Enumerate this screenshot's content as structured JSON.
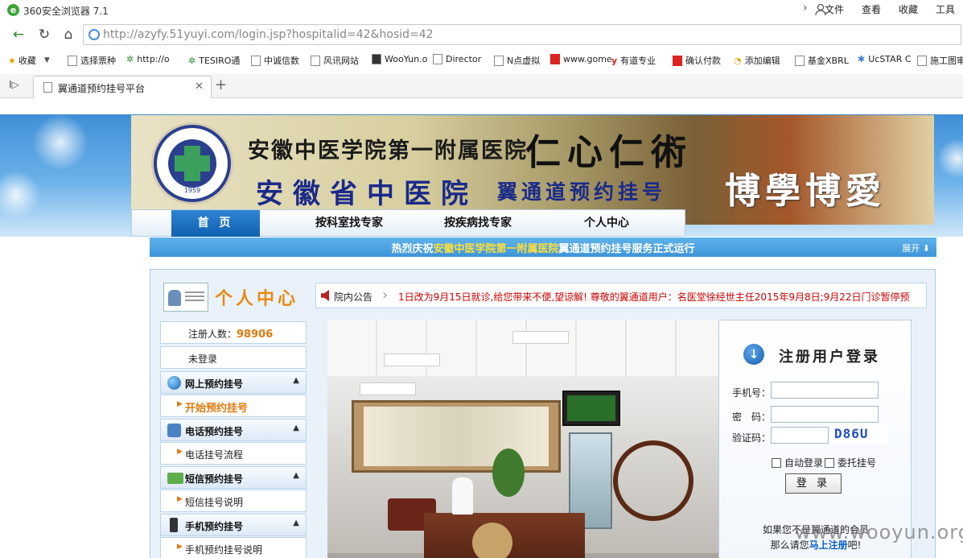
{
  "browser": {
    "app_title": "360安全浏览器 7.1",
    "menus": [
      "文件",
      "查看",
      "收藏",
      "工具"
    ],
    "url": "http://azyfy.51yuyi.com/login.jsp?hospitalid=42&hosid=42",
    "bookmarks": [
      "收藏",
      "选择票种",
      "http://o",
      "TESIRO通",
      "中诚信数",
      "风讯网站",
      "WooYun.o",
      "Director",
      "N点虚拟",
      "www.gome",
      "有道专业",
      "确认付款",
      "添加编辑",
      "基金XBRL",
      "UcSTAR C",
      "施工图审"
    ],
    "tab_title": "翼通道预约挂号平台"
  },
  "banner": {
    "seal_year": "1959",
    "line1": "安徽中医学院第一附属医院",
    "line2": "安徽省中医院",
    "line2_sub": "翼通道预约挂号",
    "calligraphy1": "仁心仁術",
    "calligraphy2": "博學博愛"
  },
  "nav": {
    "items": [
      "首 页",
      "按科室找专家",
      "按疾病找专家",
      "个人中心"
    ]
  },
  "marquee": {
    "part1": "热烈庆祝",
    "highlight": "安徽中医学院第一附属医院",
    "part2": "翼通道预约挂号服务正式运行",
    "expand": "展开"
  },
  "sidebar": {
    "title": "个人中心",
    "registered_label": "注册人数：",
    "registered_count": "98906",
    "login_status": "未登录",
    "sections": [
      {
        "title": "网上预约挂号",
        "icon": "globe-icon",
        "item": "开始预约挂号"
      },
      {
        "title": "电话预约挂号",
        "icon": "phone-icon",
        "item": "电话挂号流程"
      },
      {
        "title": "短信预约挂号",
        "icon": "sms-icon",
        "item": "短信挂号说明"
      },
      {
        "title": "手机预约挂号",
        "icon": "mobile-icon",
        "item": "手机预约挂号说明"
      }
    ]
  },
  "notice": {
    "label": "院内公告",
    "text": "1日改为9月15日就诊,给您带来不便,望谅解!   尊敬的翼通道用户：名医堂徐经世主任2015年9月8日;9月22日门诊暂停预"
  },
  "login": {
    "title": "注册用户登录",
    "phone_label": "手机号：",
    "password_label": "密　码：",
    "captcha_label": "验证码：",
    "captcha_code": "D86U",
    "auto_login": "自动登录",
    "proxy_register": "委托挂号",
    "submit": "登 录",
    "note_line1": "如果您不是翼通道的会员",
    "note_line2_pre": "那么请您",
    "note_link": "马上注册",
    "note_line2_post": "吧!"
  },
  "watermark": "www.wooyun.org",
  "colors": {
    "accent_orange": "#e07a0e",
    "nav_blue": "#1160b1",
    "link_blue": "#0a5ec9",
    "notice_red": "#cc0000"
  }
}
